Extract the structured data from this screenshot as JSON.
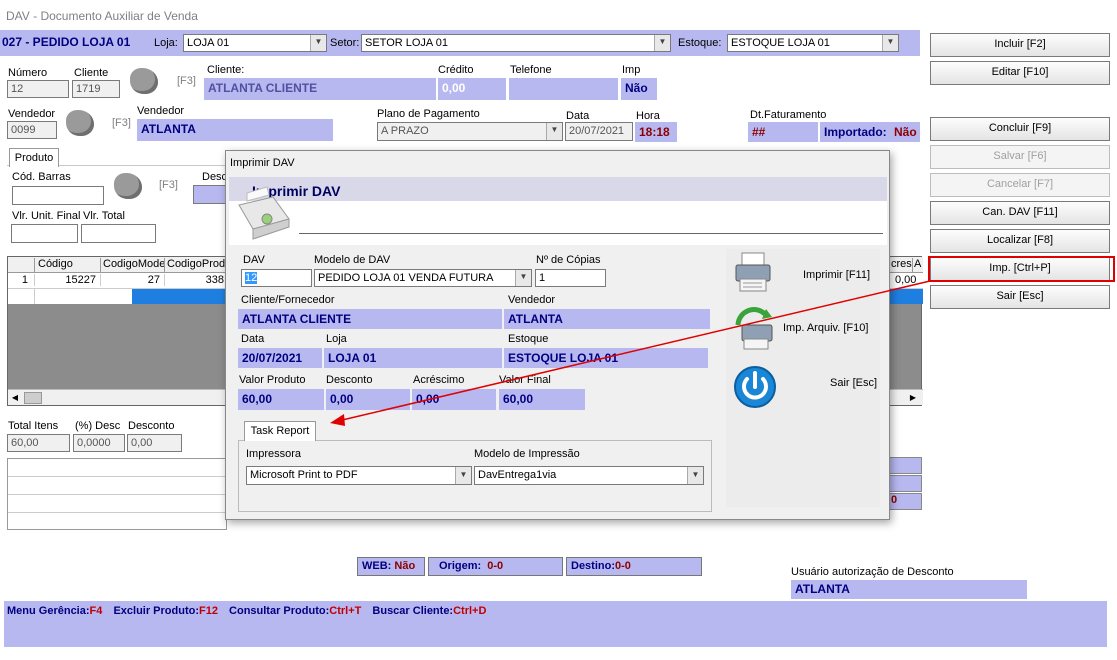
{
  "window": {
    "title": "DAV - Documento Auxiliar de Venda"
  },
  "header": {
    "order_title": "027 - PEDIDO LOJA 01",
    "loja_label": "Loja:",
    "loja_value": "LOJA 01",
    "setor_label": "Setor:",
    "setor_value": "SETOR LOJA 01",
    "estoque_label": "Estoque:",
    "estoque_value": "ESTOQUE LOJA 01"
  },
  "form": {
    "numero_label": "Número",
    "numero_value": "12",
    "cliente_label": "Cliente",
    "cliente_value": "1719",
    "f3": "[F3]",
    "cliente_name_label": "Cliente:",
    "cliente_name": "ATLANTA CLIENTE",
    "credito_label": "Crédito",
    "credito_value": "0,00",
    "telefone_label": "Telefone",
    "imp_label": "Imp",
    "imp_value": "Não",
    "vendedor_label": "Vendedor",
    "vendedor_code": "0099",
    "vendedor_name_label": "Vendedor",
    "vendedor_name": "ATLANTA",
    "plano_label": "Plano de Pagamento",
    "plano_value": "A PRAZO",
    "data_label": "Data",
    "data_value": "20/07/2021",
    "hora_label": "Hora",
    "hora_value": "18:18",
    "dt_fat_label": "Dt.Faturamento",
    "dt_fat_value": "##",
    "importado_label": "Importado:",
    "importado_value": "Não"
  },
  "product": {
    "tab_label": "Produto",
    "cod_barras_label": "Cód. Barras",
    "desc_label_partial": "Desc",
    "vlr_unit_label": "Vlr. Unit. Final",
    "vlr_total_label": "Vlr. Total"
  },
  "grid": {
    "columns": [
      "Código",
      "CodigoMode",
      "CodigoProdu"
    ],
    "right_partial_cols": [
      "cres.",
      "A"
    ],
    "rows": [
      {
        "num": "1",
        "codigo": "15227",
        "modelo": "27",
        "produto": "338",
        "partial": "0,00"
      }
    ]
  },
  "totals": {
    "total_itens_label": "Total Itens",
    "total_itens_value": "60,00",
    "desc_pct_label": "(%) Desc",
    "desc_pct_value": "0,0000",
    "desconto_label": "Desconto",
    "desconto_value": "0,00",
    "right_partial": "0"
  },
  "status": {
    "web_label": "WEB:",
    "web_value": "Não",
    "origem_label": "Origem:",
    "origem_value": "0-0",
    "destino_label": "Destino:",
    "destino_value": "0-0",
    "usuario_label": "Usuário autorização de Desconto",
    "usuario_value": "ATLANTA"
  },
  "shortcuts": [
    {
      "label": "Menu Gerência:",
      "key": "F4"
    },
    {
      "label": "Excluir Produto:",
      "key": "F12"
    },
    {
      "label": "Consultar Produto:",
      "key": "Ctrl+T"
    },
    {
      "label": "Buscar Cliente:",
      "key": "Ctrl+D"
    }
  ],
  "side_buttons": {
    "incluir": "Incluir [F2]",
    "editar": "Editar [F10]",
    "concluir": "Concluir [F9]",
    "salvar": "Salvar [F6]",
    "cancelar": "Cancelar [F7]",
    "can_dav": "Can. DAV [F11]",
    "localizar": "Localizar [F8]",
    "imp": "Imp. [Ctrl+P]",
    "sair": "Sair [Esc]"
  },
  "dialog": {
    "title": "Imprimir DAV",
    "heading": "Imprimir DAV",
    "dav_label": "DAV",
    "dav_value": "12",
    "modelo_label": "Modelo de DAV",
    "modelo_value": "PEDIDO LOJA 01 VENDA FUTURA",
    "copias_label": "Nº de Cópias",
    "copias_value": "1",
    "cliente_label": "Cliente/Fornecedor",
    "cliente_value": "ATLANTA CLIENTE",
    "vendedor_label": "Vendedor",
    "vendedor_value": "ATLANTA",
    "data_label": "Data",
    "data_value": "20/07/2021",
    "loja_label": "Loja",
    "loja_value": "LOJA 01",
    "estoque_label": "Estoque",
    "estoque_value": "ESTOQUE LOJA 01",
    "valor_produto_label": "Valor Produto",
    "valor_produto_value": "60,00",
    "desconto_label": "Desconto",
    "desconto_value": "0,00",
    "acrescimo_label": "Acréscimo",
    "acrescimo_value": "0,00",
    "valor_final_label": "Valor Final",
    "valor_final_value": "60,00",
    "tab_label": "Task Report",
    "impressora_label": "Impressora",
    "impressora_value": "Microsoft Print to PDF",
    "modelo_impressao_label": "Modelo de Impressão",
    "modelo_impressao_value": "DavEntrega1via",
    "btn_imprimir": "Imprimir [F11]",
    "btn_imp_arquiv": "Imp. Arquiv. [F10]",
    "btn_sair": "Sair [Esc]"
  },
  "colors": {
    "accent_lavender": "#b8b8f0",
    "dark_red": "#8b0000",
    "annotation_red": "#e00000"
  }
}
